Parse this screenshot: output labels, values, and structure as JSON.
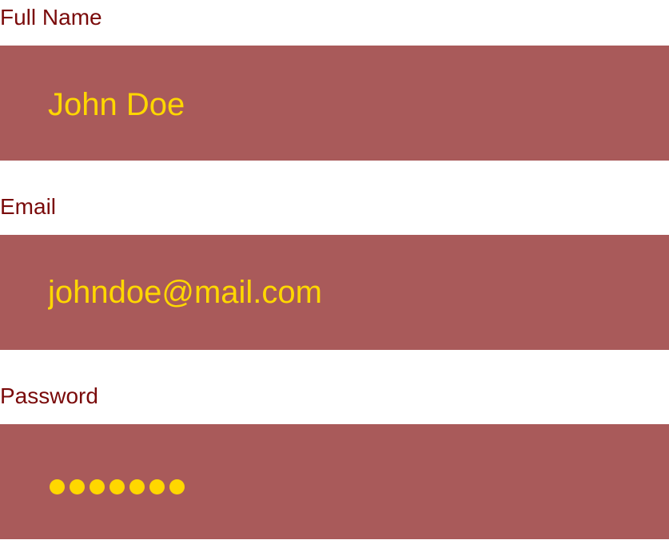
{
  "form": {
    "full_name": {
      "label": "Full Name",
      "value": "John Doe"
    },
    "email": {
      "label": "Email",
      "value": "johndoe@mail.com"
    },
    "password": {
      "label": "Password",
      "masked_length": 7
    }
  },
  "colors": {
    "label": "#7a0a0a",
    "field_background": "#a95a5a",
    "field_text": "#ffd700",
    "page_background": "#ffffff"
  }
}
